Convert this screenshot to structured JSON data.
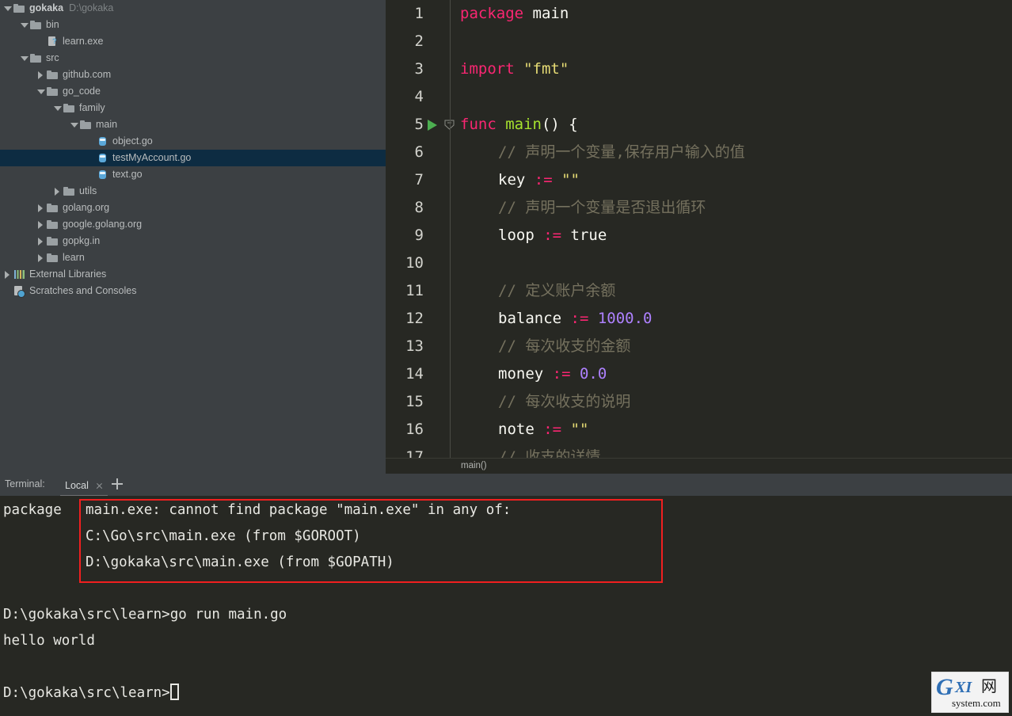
{
  "app": {
    "ide": "GoLand",
    "colors": {
      "editor_bg": "#272823",
      "panel_bg": "#3c4043",
      "selection_bg": "#0d2c42",
      "accent_red": "#f01f1f",
      "run_green": "#4caf50"
    }
  },
  "project": {
    "items": [
      {
        "label": "gokaka",
        "sub": "D:\\gokaka",
        "icon": "folder-icon",
        "twisty": "open",
        "indent": 0,
        "bold": true,
        "selected": false
      },
      {
        "label": "bin",
        "sub": "",
        "icon": "folder-icon",
        "twisty": "open",
        "indent": 1,
        "bold": false,
        "selected": false
      },
      {
        "label": "learn.exe",
        "sub": "",
        "icon": "exe-file-icon",
        "twisty": "none",
        "indent": 2,
        "bold": false,
        "selected": false
      },
      {
        "label": "src",
        "sub": "",
        "icon": "folder-icon",
        "twisty": "open",
        "indent": 1,
        "bold": false,
        "selected": false
      },
      {
        "label": "github.com",
        "sub": "",
        "icon": "folder-icon",
        "twisty": "closed",
        "indent": 2,
        "bold": false,
        "selected": false
      },
      {
        "label": "go_code",
        "sub": "",
        "icon": "folder-icon",
        "twisty": "open",
        "indent": 2,
        "bold": false,
        "selected": false
      },
      {
        "label": "family",
        "sub": "",
        "icon": "folder-icon",
        "twisty": "open",
        "indent": 3,
        "bold": false,
        "selected": false
      },
      {
        "label": "main",
        "sub": "",
        "icon": "folder-icon",
        "twisty": "open",
        "indent": 4,
        "bold": false,
        "selected": false
      },
      {
        "label": "object.go",
        "sub": "",
        "icon": "go-file-icon",
        "twisty": "none",
        "indent": 5,
        "bold": false,
        "selected": false
      },
      {
        "label": "testMyAccount.go",
        "sub": "",
        "icon": "go-file-icon",
        "twisty": "none",
        "indent": 5,
        "bold": false,
        "selected": true
      },
      {
        "label": "text.go",
        "sub": "",
        "icon": "go-file-icon",
        "twisty": "none",
        "indent": 5,
        "bold": false,
        "selected": false
      },
      {
        "label": "utils",
        "sub": "",
        "icon": "folder-icon",
        "twisty": "closed",
        "indent": 3,
        "bold": false,
        "selected": false
      },
      {
        "label": "golang.org",
        "sub": "",
        "icon": "folder-icon",
        "twisty": "closed",
        "indent": 2,
        "bold": false,
        "selected": false
      },
      {
        "label": "google.golang.org",
        "sub": "",
        "icon": "folder-icon",
        "twisty": "closed",
        "indent": 2,
        "bold": false,
        "selected": false
      },
      {
        "label": "gopkg.in",
        "sub": "",
        "icon": "folder-icon",
        "twisty": "closed",
        "indent": 2,
        "bold": false,
        "selected": false
      },
      {
        "label": "learn",
        "sub": "",
        "icon": "folder-icon",
        "twisty": "closed",
        "indent": 2,
        "bold": false,
        "selected": false
      },
      {
        "label": "External Libraries",
        "sub": "",
        "icon": "libraries-icon",
        "twisty": "closed",
        "indent": 0,
        "bold": false,
        "selected": false
      },
      {
        "label": "Scratches and Consoles",
        "sub": "",
        "icon": "scratches-icon",
        "twisty": "none",
        "indent": 0,
        "bold": false,
        "selected": false
      }
    ]
  },
  "editor": {
    "lines": [
      {
        "n": "1",
        "indent": 0,
        "run": false,
        "fold": false,
        "tokens": [
          {
            "t": "package",
            "c": "kw"
          },
          {
            "t": " ",
            "c": "pl"
          },
          {
            "t": "main",
            "c": "pl"
          }
        ]
      },
      {
        "n": "2",
        "indent": 0,
        "run": false,
        "fold": false,
        "tokens": []
      },
      {
        "n": "3",
        "indent": 0,
        "run": false,
        "fold": false,
        "tokens": [
          {
            "t": "import",
            "c": "kw"
          },
          {
            "t": " ",
            "c": "pl"
          },
          {
            "t": "\"fmt\"",
            "c": "str"
          }
        ]
      },
      {
        "n": "4",
        "indent": 0,
        "run": false,
        "fold": false,
        "tokens": []
      },
      {
        "n": "5",
        "indent": 0,
        "run": true,
        "fold": true,
        "tokens": [
          {
            "t": "func",
            "c": "kw"
          },
          {
            "t": " ",
            "c": "pl"
          },
          {
            "t": "main",
            "c": "fn"
          },
          {
            "t": "() {",
            "c": "pl"
          }
        ]
      },
      {
        "n": "6",
        "indent": 1,
        "run": false,
        "fold": false,
        "tokens": [
          {
            "t": "// 声明一个变量,保存用户输入的值",
            "c": "cmt"
          }
        ]
      },
      {
        "n": "7",
        "indent": 1,
        "run": false,
        "fold": false,
        "tokens": [
          {
            "t": "key ",
            "c": "pl"
          },
          {
            "t": ":=",
            "c": "op"
          },
          {
            "t": " ",
            "c": "pl"
          },
          {
            "t": "\"\"",
            "c": "str"
          }
        ]
      },
      {
        "n": "8",
        "indent": 1,
        "run": false,
        "fold": false,
        "tokens": [
          {
            "t": "// 声明一个变量是否退出循环",
            "c": "cmt"
          }
        ]
      },
      {
        "n": "9",
        "indent": 1,
        "run": false,
        "fold": false,
        "tokens": [
          {
            "t": "loop ",
            "c": "pl"
          },
          {
            "t": ":=",
            "c": "op"
          },
          {
            "t": " ",
            "c": "pl"
          },
          {
            "t": "true",
            "c": "pl"
          }
        ]
      },
      {
        "n": "10",
        "indent": 0,
        "run": false,
        "fold": false,
        "tokens": []
      },
      {
        "n": "11",
        "indent": 1,
        "run": false,
        "fold": false,
        "tokens": [
          {
            "t": "// 定义账户余额",
            "c": "cmt"
          }
        ]
      },
      {
        "n": "12",
        "indent": 1,
        "run": false,
        "fold": false,
        "tokens": [
          {
            "t": "balance ",
            "c": "pl"
          },
          {
            "t": ":=",
            "c": "op"
          },
          {
            "t": " ",
            "c": "pl"
          },
          {
            "t": "1000.0",
            "c": "num"
          }
        ]
      },
      {
        "n": "13",
        "indent": 1,
        "run": false,
        "fold": false,
        "tokens": [
          {
            "t": "// 每次收支的金额",
            "c": "cmt"
          }
        ]
      },
      {
        "n": "14",
        "indent": 1,
        "run": false,
        "fold": false,
        "tokens": [
          {
            "t": "money ",
            "c": "pl"
          },
          {
            "t": ":=",
            "c": "op"
          },
          {
            "t": " ",
            "c": "pl"
          },
          {
            "t": "0.0",
            "c": "num"
          }
        ]
      },
      {
        "n": "15",
        "indent": 1,
        "run": false,
        "fold": false,
        "tokens": [
          {
            "t": "// 每次收支的说明",
            "c": "cmt"
          }
        ]
      },
      {
        "n": "16",
        "indent": 1,
        "run": false,
        "fold": false,
        "tokens": [
          {
            "t": "note ",
            "c": "pl"
          },
          {
            "t": ":=",
            "c": "op"
          },
          {
            "t": " ",
            "c": "pl"
          },
          {
            "t": "\"\"",
            "c": "str"
          }
        ]
      },
      {
        "n": "17",
        "indent": 1,
        "run": false,
        "fold": false,
        "tokens": [
          {
            "t": "// 收支的详情",
            "c": "cmt"
          }
        ]
      }
    ],
    "breadcrumb": "main()"
  },
  "terminal": {
    "label": "Terminal:",
    "tab_name": "Local",
    "close_icon": "close-icon",
    "add_icon": "plus-icon",
    "prefix_text": "package",
    "error_lines": [
      "main.exe: cannot find package \"main.exe\" in any of:",
      "C:\\Go\\src\\main.exe (from $GOROOT)",
      "D:\\gokaka\\src\\main.exe (from $GOPATH)"
    ],
    "output_lines": [
      "D:\\gokaka\\src\\learn>go run main.go",
      "hello world"
    ],
    "prompt": "D:\\gokaka\\src\\learn>"
  },
  "watermark": {
    "g": "G",
    "xi": "XI",
    "cn": "网",
    "domain": "system.com"
  }
}
